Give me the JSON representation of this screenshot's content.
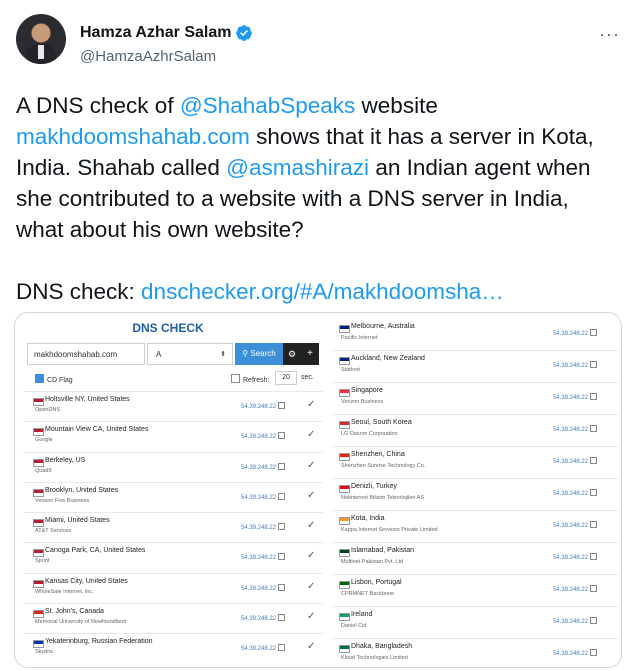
{
  "author": {
    "name": "Hamza Azhar Salam",
    "handle": "@HamzaAzhrSalam"
  },
  "more": "···",
  "tweet": {
    "p1_a": "A DNS check of ",
    "p1_link1": "@ShahabSpeaks",
    "p1_b": " website",
    "p1_link2": "makhdoomshahab.com",
    "p1_c": " shows that it has a server in Kota, India. Shahab called ",
    "p1_link3": "@asmashirazi",
    "p1_d": " an Indian agent when she contributed to a website with a DNS server in India, what about his own website?",
    "p2_a": "DNS check: ",
    "p2_link": "dnschecker.org/#A/makhdoomsha…"
  },
  "dns": {
    "title": "DNS CHECK",
    "domain": "makhdoomshahab.com",
    "type": "A",
    "search_label": "Search",
    "gear": "⚙",
    "plus": "+",
    "cdflag_label": "CD Flag",
    "refresh_label": "Refresh:",
    "refresh_value": "20",
    "sec_label": "sec.",
    "left_rows": [
      {
        "loc": "Holtsville NY, United States",
        "isp": "OpenDNS",
        "ip": "54.39.248.22",
        "flag": "#b22234"
      },
      {
        "loc": "Mountain View CA, United States",
        "isp": "Google",
        "ip": "54.39.248.22",
        "flag": "#b22234"
      },
      {
        "loc": "Berkeley, US",
        "isp": "Quad9",
        "ip": "54.39.248.22",
        "flag": "#b22234"
      },
      {
        "loc": "Brooklyn, United States",
        "isp": "Verizon Fios Business",
        "ip": "54.39.248.22",
        "flag": "#b22234"
      },
      {
        "loc": "Miami, United States",
        "isp": "AT&T Services",
        "ip": "54.39.248.22",
        "flag": "#b22234"
      },
      {
        "loc": "Canoga Park, CA, United States",
        "isp": "Sprint",
        "ip": "54.39.248.22",
        "flag": "#b22234"
      },
      {
        "loc": "Kansas City, United States",
        "isp": "WholeSale Internet, Inc.",
        "ip": "54.39.248.22",
        "flag": "#b22234"
      },
      {
        "loc": "St. John's, Canada",
        "isp": "Memorial University of Newfoundland",
        "ip": "54.39.248.22",
        "flag": "#d52b1e"
      },
      {
        "loc": "Yekaterinburg, Russian Federation",
        "isp": "Skydns",
        "ip": "54.39.248.22",
        "flag": "#0039a6"
      }
    ],
    "right_rows": [
      {
        "loc": "Melbourne, Australia",
        "isp": "Pacific Internet",
        "ip": "54.39.248.22",
        "flag": "#00247d"
      },
      {
        "loc": "Auckland, New Zealand",
        "isp": "Starlnet",
        "ip": "54.39.248.22",
        "flag": "#00247d"
      },
      {
        "loc": "Singapore",
        "isp": "Verizon Business",
        "ip": "54.39.248.22",
        "flag": "#ef3340"
      },
      {
        "loc": "Seoul, South Korea",
        "isp": "LG Dacom Corporation",
        "ip": "54.39.248.22",
        "flag": "#cd2e3a"
      },
      {
        "loc": "Shenzhen, China",
        "isp": "Shenzhen Sunrise Technology Co.",
        "ip": "54.39.248.22",
        "flag": "#de2910"
      },
      {
        "loc": "Denizli, Turkey",
        "isp": "Netinternet Bilisim Teknolojileri AS",
        "ip": "54.39.248.22",
        "flag": "#e30a17"
      },
      {
        "loc": "Kota, India",
        "isp": "Kappa Internet Services Private Limited",
        "ip": "54.39.248.22",
        "flag": "#ff9933"
      },
      {
        "loc": "Islamabad, Pakistan",
        "isp": "Multinet Pakistan Pvt. Ltd",
        "ip": "54.39.248.22",
        "flag": "#01411c"
      },
      {
        "loc": "Lisbon, Portugal",
        "isp": "CPRMNET Backbone",
        "ip": "54.39.248.22",
        "flag": "#006600"
      },
      {
        "loc": "Ireland",
        "isp": "Daniel Cid",
        "ip": "54.39.248.22",
        "flag": "#169b62"
      },
      {
        "loc": "Dhaka, Bangladesh",
        "isp": "Kloud Technologies Limited",
        "ip": "54.39.248.22",
        "flag": "#006a4e"
      }
    ]
  }
}
